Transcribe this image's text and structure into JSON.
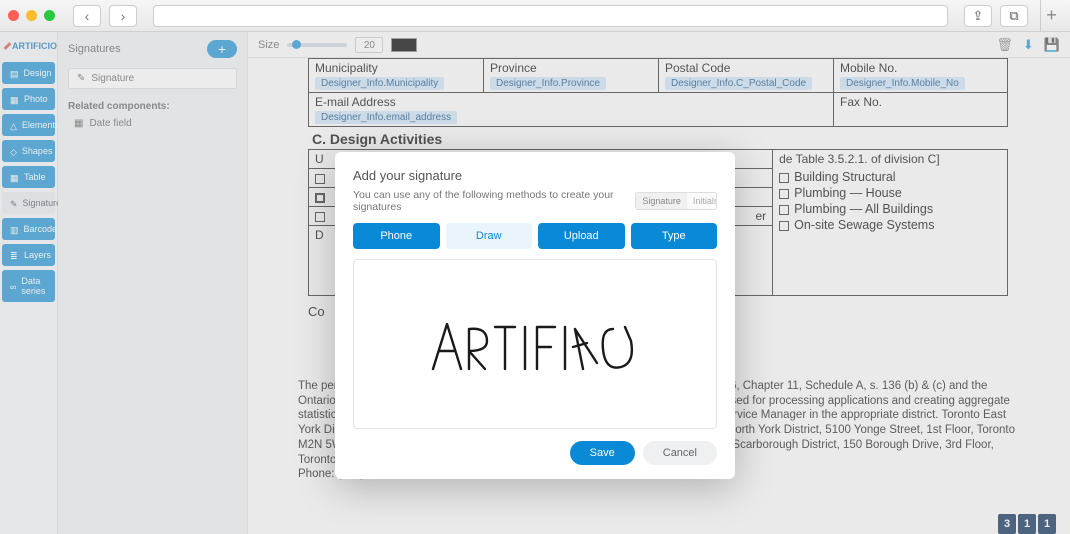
{
  "brand": "ARTIFICIO",
  "rail": {
    "items": [
      {
        "label": "Design",
        "icon": "page"
      },
      {
        "label": "Photo",
        "icon": "image"
      },
      {
        "label": "Elements",
        "icon": "triangle"
      },
      {
        "label": "Shapes",
        "icon": "shape"
      },
      {
        "label": "Table",
        "icon": "grid"
      },
      {
        "label": "Signatures",
        "icon": "pen",
        "selected": true
      },
      {
        "label": "Barcode",
        "icon": "barcode"
      },
      {
        "label": "Layers",
        "icon": "layers"
      },
      {
        "label": "Data series",
        "icon": "link"
      }
    ]
  },
  "panel2": {
    "title": "Signatures",
    "add": "+",
    "sig_row": "Signature",
    "related_label": "Related components:",
    "date_field": "Date field"
  },
  "toolbar": {
    "size_label": "Size",
    "size_value": "20"
  },
  "form": {
    "row1": {
      "municipality": "Municipality",
      "municipality_tok": "Designer_Info.Municipality",
      "province": "Province",
      "province_tok": "Designer_Info.Province",
      "postal": "Postal Code",
      "postal_tok": "Designer_Info.C_Postal_Code",
      "mobile": "Mobile No.",
      "mobile_tok": "Designer_Info.Mobile_No"
    },
    "row2": {
      "email": "E-mail Address",
      "email_tok": "Designer_Info.email_address",
      "fax": "Fax No."
    },
    "sectionC": "C.  Design Activities",
    "u_prefix": "U",
    "de_hint": "de Table 3.5.2.1. of division C]",
    "er_hint": "er",
    "checks": [
      "Building Structural",
      "Plumbing  —  House",
      "Plumbing  —  All Buildings",
      "On-site Sewage Systems"
    ],
    "D": "D",
    "Co": "Co",
    "footer": "The personal information ___ ___ ___ ___ ___ ___ ___ City of Toronto Act, S.O. 2006, Chapter 11, Schedule A, s. 136 (b) & (c) and the Ontario Building Code Act, S.O. 1992, Chapter 23. The information collected will be used for processing applications and creating aggregate statistical reports. Questions about this collection may be referred to the Customer Service Manager in the appropriate district. Toronto East York District, 100 Queen Street West, Ground Floor, West Tower, Toronto M5H 2N2; North York District, 5100 Yonge Street, 1st Floor, Toronto M2N 5W4; Etobicoke York District, 2 Civic Centre Court, 1st Floor, Toronto M9C 2Y2; Scarborough District, 150 Borough Drive, 3rd Floor, Toronto  M1P 4N7.",
    "phone": "Phone: (416) 397-5330"
  },
  "modal": {
    "title": "Add your signature",
    "sub": "You can use any of the following methods to create your signatures",
    "toggle": {
      "sig": "Signature",
      "init": "Initials"
    },
    "tabs": {
      "phone": "Phone",
      "draw": "Draw",
      "upload": "Upload",
      "type": "Type"
    },
    "save": "Save",
    "cancel": "Cancel"
  },
  "pager": [
    "3",
    "1",
    "1"
  ]
}
